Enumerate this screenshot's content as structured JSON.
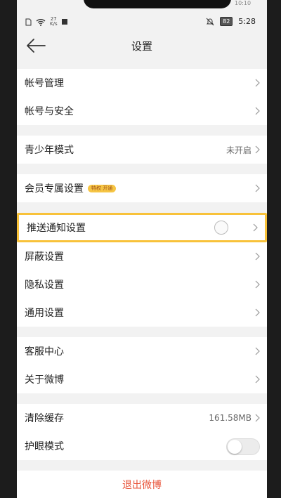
{
  "status": {
    "speed_value": "27",
    "speed_unit": "K/s",
    "battery": "82",
    "time": "5:28",
    "top_time": "10:10"
  },
  "header": {
    "title": "设置"
  },
  "groups": [
    {
      "items": [
        {
          "label": "帐号管理"
        },
        {
          "label": "帐号与安全"
        }
      ]
    },
    {
      "items": [
        {
          "label": "青少年模式",
          "value": "未开启"
        }
      ]
    },
    {
      "items": [
        {
          "label": "会员专属设置",
          "badge": "特权 开通"
        }
      ]
    },
    {
      "items": [
        {
          "label": "推送通知设置"
        },
        {
          "label": "屏蔽设置"
        },
        {
          "label": "隐私设置"
        },
        {
          "label": "通用设置"
        }
      ]
    },
    {
      "items": [
        {
          "label": "客服中心"
        },
        {
          "label": "关于微博"
        }
      ]
    },
    {
      "items": [
        {
          "label": "清除缓存",
          "value": "161.58MB"
        },
        {
          "label": "护眼模式"
        }
      ]
    }
  ],
  "logout_label": "退出微博",
  "colors": {
    "highlight": "#f8c23a",
    "logout": "#e8543a",
    "background": "#f2f2f2"
  }
}
